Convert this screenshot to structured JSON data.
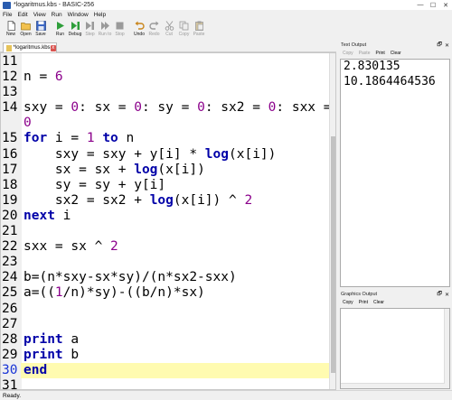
{
  "window": {
    "title": "*logaritmus.kbs - BASIC-256",
    "minimize": "—",
    "maximize": "☐",
    "close": "✕"
  },
  "menu": [
    "File",
    "Edit",
    "View",
    "Run",
    "Window",
    "Help"
  ],
  "toolbar": [
    {
      "label": "New",
      "icon": "new-file-icon",
      "enabled": true
    },
    {
      "label": "Open",
      "icon": "open-folder-icon",
      "enabled": true
    },
    {
      "label": "Save",
      "icon": "save-disk-icon",
      "enabled": true
    },
    {
      "label": "Run",
      "icon": "run-icon",
      "enabled": true
    },
    {
      "label": "Debug",
      "icon": "debug-icon",
      "enabled": true
    },
    {
      "label": "Step",
      "icon": "step-icon",
      "enabled": false
    },
    {
      "label": "Run to",
      "icon": "run-to-icon",
      "enabled": false
    },
    {
      "label": "Stop",
      "icon": "stop-icon",
      "enabled": false
    },
    {
      "label": "Undo",
      "icon": "undo-icon",
      "enabled": true
    },
    {
      "label": "Redo",
      "icon": "redo-icon",
      "enabled": false
    },
    {
      "label": "Cut",
      "icon": "cut-icon",
      "enabled": false
    },
    {
      "label": "Copy",
      "icon": "copy-icon",
      "enabled": false
    },
    {
      "label": "Paste",
      "icon": "paste-icon",
      "enabled": false
    }
  ],
  "tab": {
    "label": "*logaritmus.kbs",
    "close": "x"
  },
  "editor": {
    "current_line": "30",
    "lines": [
      {
        "n": "11",
        "code": ""
      },
      {
        "n": "12",
        "code": "n = 6"
      },
      {
        "n": "13",
        "code": ""
      },
      {
        "n": "14",
        "code": "sxy = 0: sx = 0: sy = 0: sx2 = 0: sxx ="
      },
      {
        "n": "",
        "code": "0"
      },
      {
        "n": "15",
        "code": "for i = 1 to n"
      },
      {
        "n": "16",
        "code": "    sxy = sxy + y[i] * log(x[i])"
      },
      {
        "n": "17",
        "code": "    sx = sx + log(x[i])"
      },
      {
        "n": "18",
        "code": "    sy = sy + y[i]"
      },
      {
        "n": "19",
        "code": "    sx2 = sx2 + log(x[i]) ^ 2"
      },
      {
        "n": "20",
        "code": "next i"
      },
      {
        "n": "21",
        "code": ""
      },
      {
        "n": "22",
        "code": "sxx = sx ^ 2"
      },
      {
        "n": "23",
        "code": ""
      },
      {
        "n": "24",
        "code": "b=(n*sxy-sx*sy)/(n*sx2-sxx)"
      },
      {
        "n": "25",
        "code": "a=((1/n)*sy)-((b/n)*sx)"
      },
      {
        "n": "26",
        "code": ""
      },
      {
        "n": "27",
        "code": ""
      },
      {
        "n": "28",
        "code": "print a"
      },
      {
        "n": "29",
        "code": "print b"
      },
      {
        "n": "30",
        "code": "end"
      },
      {
        "n": "31",
        "code": ""
      }
    ]
  },
  "text_output": {
    "title": "Text Output",
    "tools": [
      "Copy",
      "Paste",
      "Print",
      "Clear"
    ],
    "lines": [
      "2.830135",
      "10.1864464536"
    ]
  },
  "graphics_output": {
    "title": "Graphics Output",
    "tools": [
      "Copy",
      "Print",
      "Clear"
    ]
  },
  "panel_buttons": {
    "float": "🗗",
    "close": "✕"
  },
  "status": "Ready.",
  "colors": {
    "keyword": "#0000a8",
    "number": "#8b008b",
    "current_line_bg": "#fffbb0",
    "current_line_number": "#1a35d6"
  }
}
